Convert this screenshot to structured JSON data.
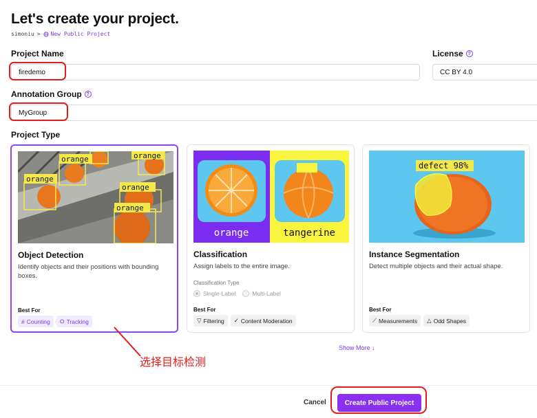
{
  "page": {
    "title": "Let's create your project.",
    "breadcrumb": {
      "user": "simoniu",
      "separator": ">",
      "current": "New Public Project"
    }
  },
  "form": {
    "project_name": {
      "label": "Project Name",
      "value": "firedemo"
    },
    "license": {
      "label": "License",
      "value": "CC BY 4.0"
    },
    "annotation_group": {
      "label": "Annotation Group",
      "value": "MyGroup"
    },
    "project_type_label": "Project Type"
  },
  "project_types": [
    {
      "title": "Object Detection",
      "description": "Identify objects and their positions with bounding boxes.",
      "best_for_label": "Best For",
      "chips": [
        "Counting",
        "Tracking"
      ],
      "image_labels": [
        "orange",
        "orange",
        "orange",
        "orange",
        "orange"
      ],
      "selected": true
    },
    {
      "title": "Classification",
      "description": "Assign labels to the entire image.",
      "classification_type_label": "Classification Type",
      "options": [
        "Single-Label",
        "Multi-Label"
      ],
      "best_for_label": "Best For",
      "chips": [
        "Filtering",
        "Content Moderation"
      ],
      "image_labels": [
        "orange",
        "tangerine"
      ]
    },
    {
      "title": "Instance Segmentation",
      "description": "Detect multiple objects and their actual shape.",
      "best_for_label": "Best For",
      "chips": [
        "Measurements",
        "Odd Shapes"
      ],
      "image_labels": [
        "defect 98%"
      ]
    }
  ],
  "show_more": "Show More",
  "annotation_note": "选择目标检测",
  "footer": {
    "cancel": "Cancel",
    "create": "Create Public Project"
  },
  "colors": {
    "accent": "#8b2ff0",
    "annotation": "#e31b1b",
    "box": "#f5e94a",
    "thumb_bg": "#5ec7f0",
    "thumb_purple": "#7a2df0"
  }
}
